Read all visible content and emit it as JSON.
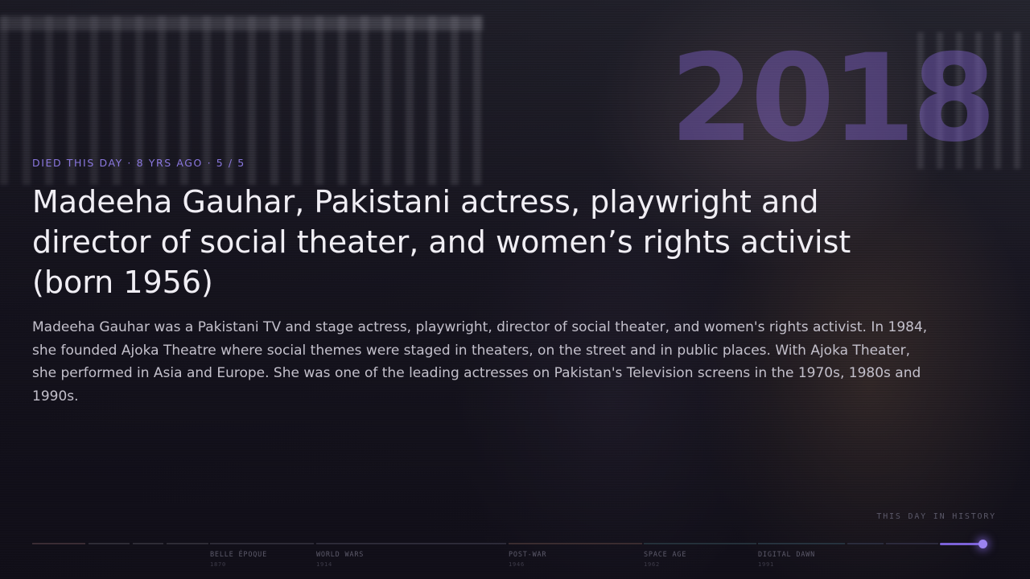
{
  "entry": {
    "year": "2018",
    "eyebrow": "DIED THIS DAY · 8 YRS AGO · 5 / 5",
    "title": "Madeeha Gauhar, Pakistani actress, playwright and director of social theater, and women’s rights activist (born 1956)",
    "description": "Madeeha Gauhar was a Pakistani TV and stage actress, playwright, director of social theater, and women's rights activist. In 1984, she founded Ajoka Theatre where social themes were staged in theaters, on the street and in public places. With Ajoka Theater, she performed in Asia and Europe. She was one of the leading actresses on Pakistan's Television screens in the 1970s, 1980s and 1990s."
  },
  "brand": "THIS DAY IN HISTORY",
  "timeline": {
    "eras": [
      {
        "label": "BELLE ÉPOQUE",
        "year": "1870"
      },
      {
        "label": "WORLD WARS",
        "year": "1914"
      },
      {
        "label": "POST-WAR",
        "year": "1946"
      },
      {
        "label": "SPACE AGE",
        "year": "1962"
      },
      {
        "label": "DIGITAL DAWN",
        "year": "1991"
      }
    ],
    "colors": {
      "accent": "#7c62d8",
      "handle": "#9b83f0"
    }
  },
  "colors": {
    "eyebrow": "#8b78e0",
    "year": "#8264d2",
    "title": "#f0eef4",
    "body": "#c3c0cb"
  }
}
